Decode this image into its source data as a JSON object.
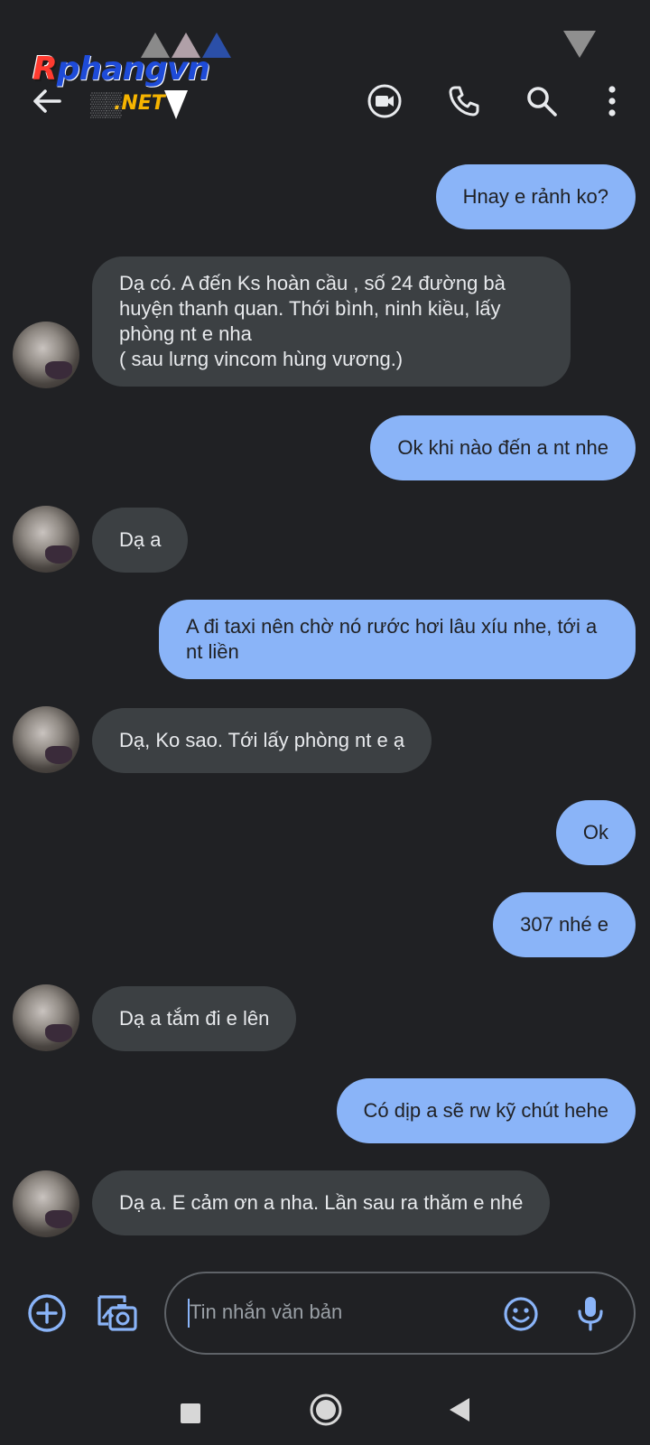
{
  "watermark": {
    "brand": "Rphangvn",
    "brand_first": "R",
    "brand_rest": "phangvn",
    "tld": ".NET"
  },
  "header": {
    "contact_name": "▒▒",
    "icons": [
      "back-arrow-icon",
      "video-call-icon",
      "phone-icon",
      "search-icon",
      "more-vert-icon"
    ]
  },
  "messages": [
    {
      "dir": "out",
      "text": "Hnay e rảnh ko?"
    },
    {
      "dir": "in",
      "text": "Dạ có. A đến Ks hoàn cầu , số 24 đường bà\nhuyện thanh quan. Thới bình, ninh kiều, lấy\nphòng nt e nha\n( sau lưng vincom hùng vương.)"
    },
    {
      "dir": "out",
      "text": "Ok khi nào đến a nt nhe"
    },
    {
      "dir": "in",
      "text": "Dạ a"
    },
    {
      "dir": "out",
      "text": "A đi taxi nên chờ nó rước hơi lâu xíu nhe, tới a\nnt liền"
    },
    {
      "dir": "in",
      "text": "Dạ, Ko sao. Tới lấy phòng nt e ạ"
    },
    {
      "dir": "out",
      "text": "Ok"
    },
    {
      "dir": "out",
      "text": "307 nhé e"
    },
    {
      "dir": "in",
      "text": "Dạ a tắm đi e lên"
    },
    {
      "dir": "out",
      "text": "Có dịp a sẽ rw kỹ chút hehe"
    },
    {
      "dir": "in",
      "text": "Dạ a. E cảm ơn a nha. Lần sau ra thăm e nhé"
    }
  ],
  "composer": {
    "placeholder": "Tin nhắn văn bản",
    "icons": [
      "add-icon",
      "gallery-camera-icon",
      "emoji-icon",
      "mic-icon"
    ]
  },
  "navbar": {
    "icons": [
      "recents-icon",
      "home-icon",
      "back-icon"
    ]
  },
  "colors": {
    "background": "#202124",
    "outgoing_bubble": "#8ab4f8",
    "incoming_bubble": "#3c4043",
    "accent": "#8ab4f8"
  }
}
